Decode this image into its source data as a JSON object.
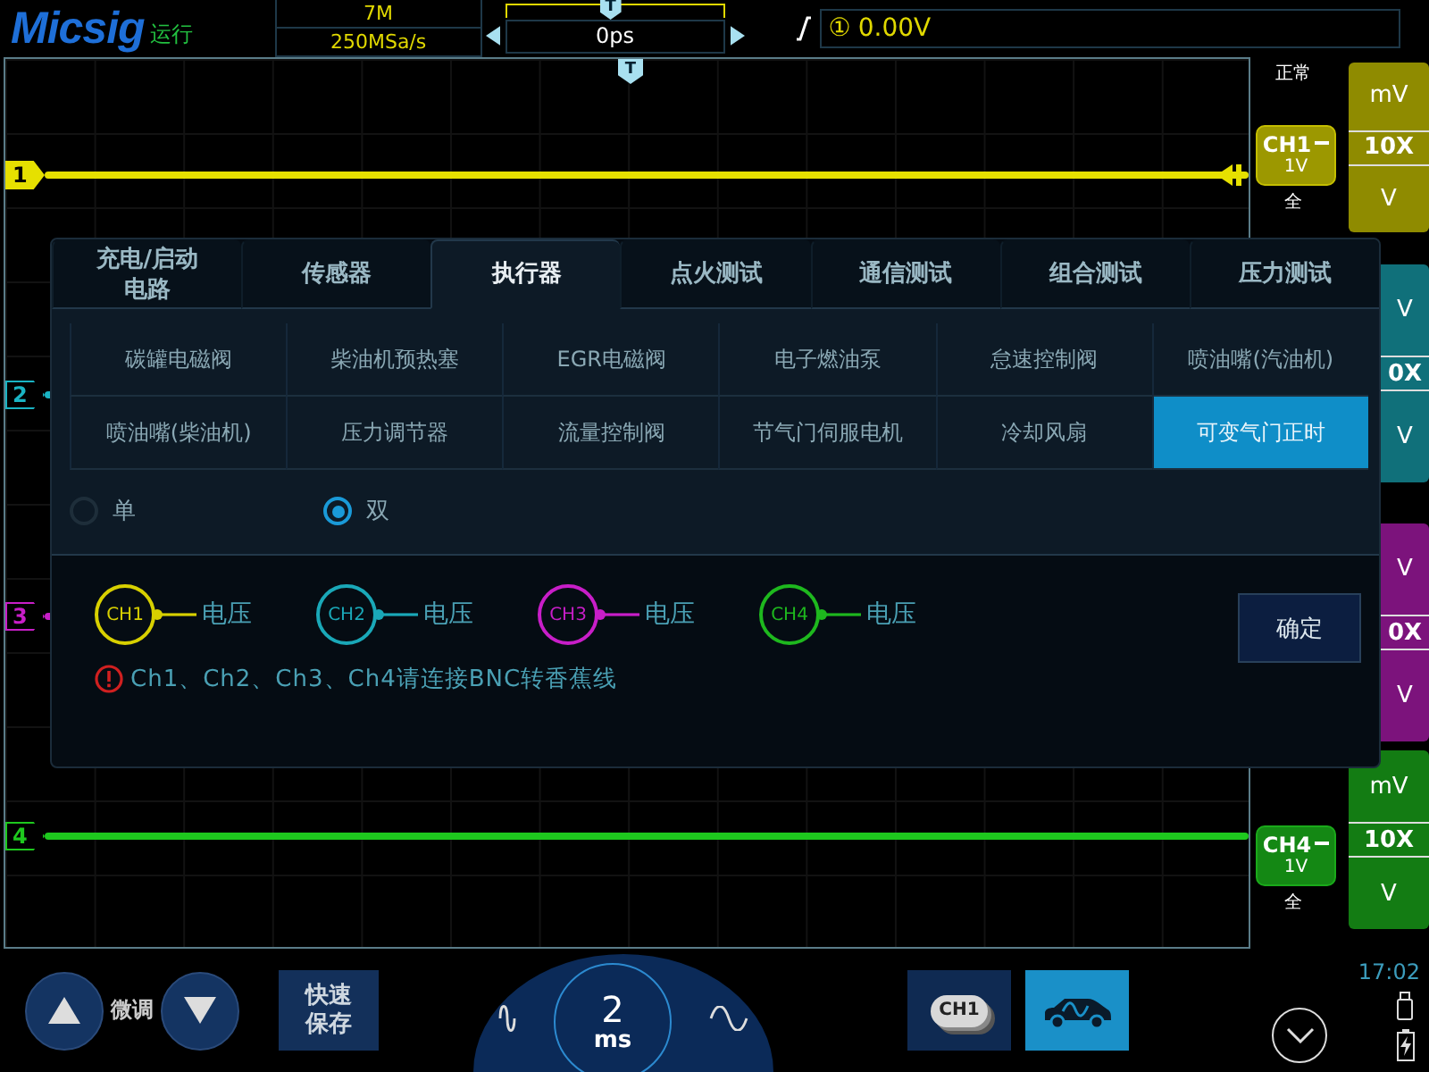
{
  "header": {
    "brand": "Micsig",
    "run_state": "运行",
    "memory_depth": "7M",
    "sample_rate": "250MSa/s",
    "trigger_marker": "T",
    "time_offset": "0ps",
    "trigger_source": "①",
    "trigger_level": "0.00V"
  },
  "acquisition_mode": "正常",
  "grid": {
    "trigger_marker": "T"
  },
  "channels": [
    {
      "marker": "1",
      "color": "#e6e000",
      "scale": [
        "mV",
        "10X",
        "V"
      ],
      "badge": {
        "name": "CH1",
        "volts": "1V",
        "range": "全"
      }
    },
    {
      "marker": "2",
      "color": "#1ab4c4",
      "scale": [
        "V",
        "0X",
        "V"
      ]
    },
    {
      "marker": "3",
      "color": "#c81ec8",
      "scale": [
        "V",
        "0X",
        "V"
      ]
    },
    {
      "marker": "4",
      "color": "#1ec81e",
      "scale": [
        "mV",
        "10X",
        "V"
      ],
      "badge": {
        "name": "CH4",
        "volts": "1V",
        "range": "全"
      }
    }
  ],
  "dialog": {
    "tabs": [
      {
        "label": "充电/启动电路",
        "selected": false
      },
      {
        "label": "传感器",
        "selected": false
      },
      {
        "label": "执行器",
        "selected": true
      },
      {
        "label": "点火测试",
        "selected": false
      },
      {
        "label": "通信测试",
        "selected": false
      },
      {
        "label": "组合测试",
        "selected": false
      },
      {
        "label": "压力测试",
        "selected": false
      }
    ],
    "items": [
      {
        "label": "碳罐电磁阀",
        "selected": false
      },
      {
        "label": "柴油机预热塞",
        "selected": false
      },
      {
        "label": "EGR电磁阀",
        "selected": false
      },
      {
        "label": "电子燃油泵",
        "selected": false
      },
      {
        "label": "怠速控制阀",
        "selected": false
      },
      {
        "label": "喷油嘴(汽油机)",
        "selected": false
      },
      {
        "label": "喷油嘴(柴油机)",
        "selected": false
      },
      {
        "label": "压力调节器",
        "selected": false
      },
      {
        "label": "流量控制阀",
        "selected": false
      },
      {
        "label": "节气门伺服电机",
        "selected": false
      },
      {
        "label": "冷却风扇",
        "selected": false
      },
      {
        "label": "可变气门正时",
        "selected": true
      }
    ],
    "modes": [
      {
        "label": "单",
        "selected": false
      },
      {
        "label": "双",
        "selected": true
      }
    ],
    "probes": [
      {
        "channel": "CH1",
        "signal": "电压",
        "color": "#d8d000"
      },
      {
        "channel": "CH2",
        "signal": "电压",
        "color": "#1aa8b8"
      },
      {
        "channel": "CH3",
        "signal": "电压",
        "color": "#c81ec8"
      },
      {
        "channel": "CH4",
        "signal": "电压",
        "color": "#1eb81e"
      }
    ],
    "warning": "Ch1、Ch2、Ch3、Ch4请连接BNC转香蕉线",
    "confirm": "确定"
  },
  "footer": {
    "fine_tune": "微调",
    "quick_save": "快速保存",
    "timebase": "2",
    "timebase_unit": "ms",
    "channel_button": "CH1",
    "time": "17:02"
  }
}
